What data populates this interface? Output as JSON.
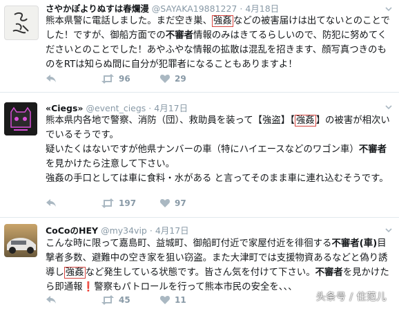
{
  "tweets": [
    {
      "name": "さやかぽよりぬすは春爛漫",
      "handle": "@SAYAKA19881227",
      "separator": "·",
      "time": "4月18日",
      "avatar_icon": "handwritten-avatar",
      "body": {
        "p1": "熊本県警に電話しました。まだ空き巣、",
        "p1_box": "強姦",
        "p1b": "などの被害届けは出てないとのことでした！ですが、御船方面での",
        "p1_bold": "不審者",
        "p1c": "情報のみはきてるらしいので、防犯に努めてくださいとのことでした！あやふやな情報の拡散は混乱を招きます、顔写真つきのものをRTは知らぬ間に自分が犯罪者になることもありますよ！"
      },
      "actions": {
        "reply": "",
        "retweet": "96",
        "like": "29"
      }
    },
    {
      "name": "«Ciegs»",
      "handle": "@event_ciegs",
      "separator": "·",
      "time": "4月17日",
      "avatar_icon": "cat-logo-avatar",
      "body": {
        "p1": "熊本県内各地で警察、消防（団）、救助員を装って【強盗】【",
        "p1_box": "強姦",
        "p1b": "】の被害が相次いでいるそうです。",
        "p2": "疑いたくはないですが他県ナンバーの車（特にハイエースなどのワゴン車）",
        "p2_bold": "不審者",
        "p2b": "を見かけたら注意して下さい。",
        "p3": "強姦の手口としては車に食料・水がある と言ってそのまま車に連れ込むそうです。"
      },
      "actions": {
        "reply": "",
        "retweet": "197",
        "like": "97"
      }
    },
    {
      "name": "CoCoのHEY",
      "handle": "@my34vip",
      "separator": "·",
      "time": "4月17日",
      "avatar_icon": "car-photo-avatar",
      "body": {
        "p1": "こんな時に限って嘉島町、益城町、御船町付近で家屋付近を徘徊する",
        "p1_bold": "不審者(車)",
        "p1b": "目撃者多数、避難中の空き家を狙い窃盗。また大津町では支援物資あるなどと偽り誘導し",
        "p1_box": "強姦",
        "p1c": "など発生している状態です。皆さん気を付けて下さい。",
        "p1_bold2": "不審者",
        "p1d": "を見かけたら即通報",
        "p1_mark": "❗",
        "p1e": "警察もパトロールを行って熊本市民の安全を、、、"
      },
      "actions": {
        "reply": "",
        "retweet": "45",
        "like": "11"
      }
    }
  ],
  "watermark": "头条号 / 住范儿",
  "colors": {
    "accent_box": "#d6433d",
    "muted": "#8899a6",
    "divider": "#e1e8ed",
    "text": "#14171a"
  }
}
